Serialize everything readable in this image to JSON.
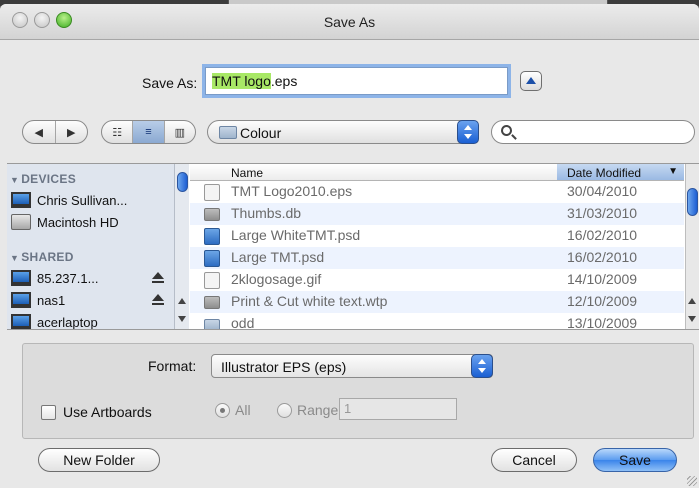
{
  "window": {
    "title": "Save As"
  },
  "save_as": {
    "label": "Save As:",
    "filename_selected": "TMT logo",
    "filename_ext": ".eps"
  },
  "toolbar": {
    "back_label": "◀",
    "forward_label": "▶",
    "view_icon_label": "☷",
    "view_list_label": "≡",
    "view_column_label": "▥",
    "folder_label": "Colour",
    "search_placeholder": ""
  },
  "sidebar": {
    "devices_heading": "DEVICES",
    "shared_heading": "SHARED",
    "devices": [
      {
        "label": "Chris Sullivan...",
        "icon": "computer-icon"
      },
      {
        "label": "Macintosh HD",
        "icon": "hard-drive-icon"
      }
    ],
    "shared": [
      {
        "label": "85.237.1...",
        "icon": "network-computer-icon",
        "ejectable": true
      },
      {
        "label": "nas1",
        "icon": "network-computer-icon",
        "ejectable": true
      },
      {
        "label": "acerlaptop",
        "icon": "network-computer-icon",
        "ejectable": false
      }
    ]
  },
  "file_list": {
    "col_name": "Name",
    "col_date": "Date Modified",
    "sort_indicator": "▼",
    "rows": [
      {
        "name": "TMT Logo2010.eps",
        "date": "30/04/2010",
        "icon": "eps-file-icon"
      },
      {
        "name": "Thumbs.db",
        "date": "31/03/2010",
        "icon": "db-file-icon"
      },
      {
        "name": "Large WhiteTMT.psd",
        "date": "16/02/2010",
        "icon": "psd-file-icon"
      },
      {
        "name": "Large TMT.psd",
        "date": "16/02/2010",
        "icon": "psd-file-icon"
      },
      {
        "name": "2klogosage.gif",
        "date": "14/10/2009",
        "icon": "gif-file-icon"
      },
      {
        "name": "Print & Cut white text.wtp",
        "date": "12/10/2009",
        "icon": "wtp-file-icon"
      },
      {
        "name": "odd",
        "date": "13/10/2009",
        "icon": "folder-icon"
      }
    ]
  },
  "options": {
    "format_label": "Format:",
    "format_value": "Illustrator EPS (eps)",
    "use_artboards_label": "Use Artboards",
    "radio_all_label": "All",
    "radio_range_label": "Range:",
    "range_value": "1"
  },
  "buttons": {
    "new_folder": "New Folder",
    "cancel": "Cancel",
    "save": "Save"
  }
}
